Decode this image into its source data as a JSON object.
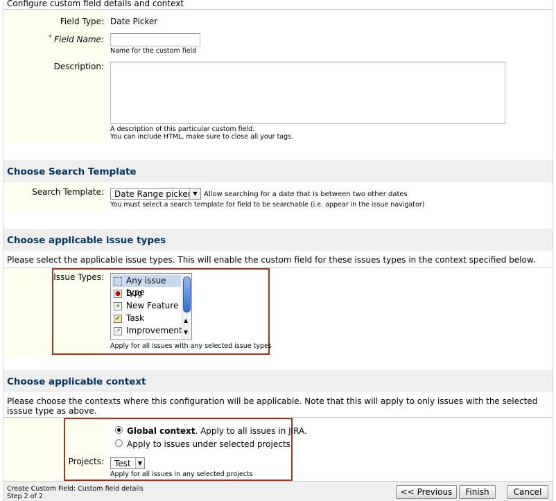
{
  "header": {
    "title": "Configure custom field details and context"
  },
  "details": {
    "field_type_label": "Field Type:",
    "field_type_value": "Date Picker",
    "field_name_required": "*",
    "field_name_label": "Field Name:",
    "field_name_value": "",
    "field_name_hint": "Name for the custom field",
    "description_label": "Description:",
    "description_value": "",
    "description_hint_1": "A description of this particular custom field.",
    "description_hint_2": "You can include HTML, make sure to close all your tags."
  },
  "search_template": {
    "heading": "Choose Search Template",
    "label": "Search Template:",
    "selected": "Date Range picker",
    "inline_hint": "Allow searching for a date that is between two other dates",
    "hint": "You must select a search template for field to be searchable (i.e. appear in the issue navigator)"
  },
  "issue_types": {
    "heading": "Choose applicable issue types",
    "intro": "Please select the applicable issue types. This will enable the custom field for these issues types in the context specified below.",
    "label": "Issue Types:",
    "options": [
      {
        "label": "Any issue type",
        "icon": "any-issue-type-icon",
        "selected": true
      },
      {
        "label": "Bug",
        "icon": "bug-icon",
        "selected": false
      },
      {
        "label": "New Feature",
        "icon": "new-feature-icon",
        "selected": false
      },
      {
        "label": "Task",
        "icon": "task-icon",
        "selected": false
      },
      {
        "label": "Improvement",
        "icon": "improvement-icon",
        "selected": false
      }
    ],
    "hint": "Apply for all issues with any selected issue types"
  },
  "context": {
    "heading": "Choose applicable context",
    "intro": "Please choose the contexts where this configuration will be applicable. Note that this will apply to only issues with the selected isssue type as above.",
    "global_bold": "Global context",
    "global_rest": ". Apply to all issues in JIRA.",
    "global_checked": true,
    "projects_option": "Apply to issues under selected projects",
    "projects_label": "Projects:",
    "projects_selected": "Test",
    "projects_hint": "Apply for all issues in any selected projects"
  },
  "footer": {
    "title": "Create Custom Field: Custom field details",
    "step": "Step 2 of 2",
    "previous_label": "<< Previous",
    "finish_label": "Finish",
    "cancel_label": "Cancel"
  },
  "colors": {
    "section_heading": "#003366",
    "label_column_bg": "#fffff0",
    "section_bg": "#efefef",
    "highlight_border": "#a1331e",
    "selected_item_bg": "#c5d9f1"
  }
}
